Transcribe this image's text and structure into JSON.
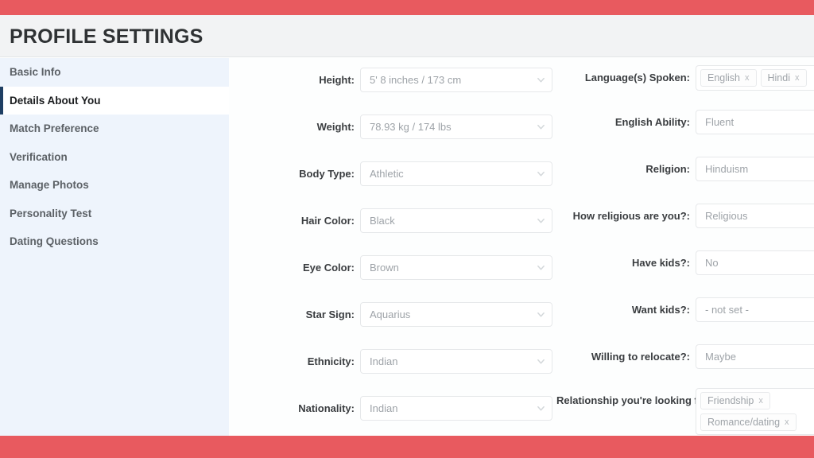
{
  "theme": {
    "accent_color": "#e85a5f",
    "sidebar_background": "#eef4fc",
    "active_indicator_color": "#1f3f63",
    "header_background": "#f2f3f4"
  },
  "header": {
    "title": "PROFILE SETTINGS"
  },
  "sidebar": {
    "items": [
      {
        "label": "Basic Info",
        "active": false
      },
      {
        "label": "Details About You",
        "active": true
      },
      {
        "label": "Match Preference",
        "active": false
      },
      {
        "label": "Verification",
        "active": false
      },
      {
        "label": "Manage Photos",
        "active": false
      },
      {
        "label": "Personality Test",
        "active": false
      },
      {
        "label": "Dating Questions",
        "active": false
      }
    ]
  },
  "form": {
    "left_column": [
      {
        "label": "Height:",
        "value": "5' 8 inches / 173 cm",
        "type": "select"
      },
      {
        "label": "Weight:",
        "value": "78.93 kg / 174 lbs",
        "type": "select"
      },
      {
        "label": "Body Type:",
        "value": "Athletic",
        "type": "select"
      },
      {
        "label": "Hair Color:",
        "value": "Black",
        "type": "select"
      },
      {
        "label": "Eye Color:",
        "value": "Brown",
        "type": "select"
      },
      {
        "label": "Star Sign:",
        "value": "Aquarius",
        "type": "select"
      },
      {
        "label": "Ethnicity:",
        "value": "Indian",
        "type": "select"
      },
      {
        "label": "Nationality:",
        "value": "Indian",
        "type": "select"
      }
    ],
    "right_column": [
      {
        "label": "Language(s) Spoken:",
        "type": "tags",
        "tags": [
          "English",
          "Hindi"
        ]
      },
      {
        "label": "English Ability:",
        "type": "select",
        "value": "Fluent"
      },
      {
        "label": "Religion:",
        "type": "select",
        "value": "Hinduism"
      },
      {
        "label": "How religious are you?:",
        "type": "select",
        "value": "Religious"
      },
      {
        "label": "Have kids?:",
        "type": "select",
        "value": "No"
      },
      {
        "label": "Want kids?:",
        "type": "select",
        "value": "- not set -"
      },
      {
        "label": "Willing to relocate?:",
        "type": "select",
        "value": "Maybe"
      },
      {
        "label": "Relationship you're looking for:",
        "type": "tags",
        "tags": [
          "Friendship",
          "Romance/dating"
        ],
        "stacked": true
      }
    ]
  },
  "icons": {
    "chevron_down": "chevron-down-icon",
    "remove": "×"
  }
}
